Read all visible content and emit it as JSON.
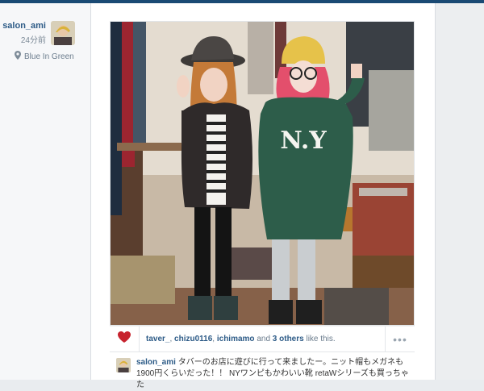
{
  "post": {
    "username": "salon_ami",
    "time": "24分前",
    "location": "Blue In Green",
    "location_icon": "map-pin-icon",
    "shirt_text": "N.Y"
  },
  "likes": {
    "user1": "taver_",
    "sep1": ", ",
    "user2": "chizu0116",
    "sep2": ", ",
    "user3": "ichimamo",
    "and_text": " and ",
    "others": "3 others",
    "suffix": " like this."
  },
  "caption": {
    "username": "salon_ami",
    "line1": "タバーのお店に遊びに行って来ましたー。ニット帽もメガネも",
    "line2": "1900円くらいだった！！ NYワンピもかわいい靴 retaWシリーズも買っちゃた"
  },
  "colors": {
    "accent": "#2d5b87",
    "heart": "#c7232e",
    "topbar": "#1a4a74"
  }
}
